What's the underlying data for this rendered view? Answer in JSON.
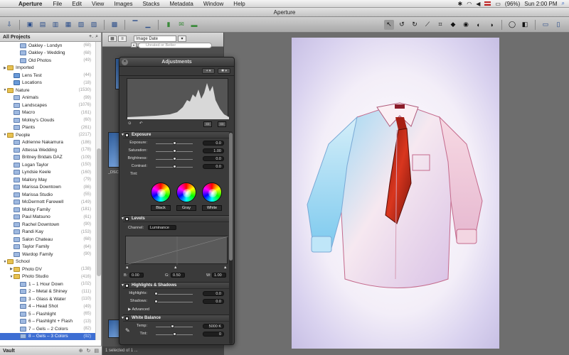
{
  "menubar": {
    "app": "Aperture",
    "items": [
      "File",
      "Edit",
      "View",
      "Images",
      "Stacks",
      "Metadata",
      "Window",
      "Help"
    ],
    "battery": "(96%)",
    "clock": "Sun 2:00 PM"
  },
  "window": {
    "title": "Aperture"
  },
  "sidebar": {
    "header": "All Projects",
    "footer": "Vault",
    "rows": [
      {
        "label": "Oakley - Londyn",
        "count": "(68)",
        "indent": 2,
        "icon": "album"
      },
      {
        "label": "Oakley - Wedding",
        "count": "(68)",
        "indent": 2,
        "icon": "album"
      },
      {
        "label": "Old Photos",
        "count": "(49)",
        "indent": 2,
        "icon": "album"
      },
      {
        "label": "Imported",
        "count": "",
        "indent": 0,
        "icon": "folder",
        "tri": "▶"
      },
      {
        "label": "Lens Test",
        "count": "(44)",
        "indent": 1,
        "icon": "proj"
      },
      {
        "label": "Locations",
        "count": "(18)",
        "indent": 1,
        "icon": "proj"
      },
      {
        "label": "Nature",
        "count": "(1530)",
        "indent": 0,
        "icon": "folder",
        "tri": "▼"
      },
      {
        "label": "Animals",
        "count": "(99)",
        "indent": 1,
        "icon": "album"
      },
      {
        "label": "Landscapes",
        "count": "(1076)",
        "indent": 1,
        "icon": "album"
      },
      {
        "label": "Macro",
        "count": "(161)",
        "indent": 1,
        "icon": "album"
      },
      {
        "label": "Molloy's Clouds",
        "count": "(60)",
        "indent": 1,
        "icon": "album"
      },
      {
        "label": "Plants",
        "count": "(261)",
        "indent": 1,
        "icon": "album"
      },
      {
        "label": "People",
        "count": "(2217)",
        "indent": 0,
        "icon": "folder",
        "tri": "▼"
      },
      {
        "label": "Adrienne Nakamura",
        "count": "(186)",
        "indent": 1,
        "icon": "album"
      },
      {
        "label": "Attessa Wedding",
        "count": "(178)",
        "indent": 1,
        "icon": "album"
      },
      {
        "label": "Britney Bridals DAZ",
        "count": "(109)",
        "indent": 1,
        "icon": "album"
      },
      {
        "label": "Logan Taylor",
        "count": "(150)",
        "indent": 1,
        "icon": "album"
      },
      {
        "label": "Lyndsie Keele",
        "count": "(160)",
        "indent": 1,
        "icon": "album"
      },
      {
        "label": "Mallory May",
        "count": "(79)",
        "indent": 1,
        "icon": "album"
      },
      {
        "label": "Marissa Downtown",
        "count": "(86)",
        "indent": 1,
        "icon": "album"
      },
      {
        "label": "Marissa Studio",
        "count": "(55)",
        "indent": 1,
        "icon": "album"
      },
      {
        "label": "McDermott Farewell",
        "count": "(149)",
        "indent": 1,
        "icon": "album"
      },
      {
        "label": "Molloy Family",
        "count": "(181)",
        "indent": 1,
        "icon": "album"
      },
      {
        "label": "Paul Matsuno",
        "count": "(61)",
        "indent": 1,
        "icon": "album"
      },
      {
        "label": "Rachel Downtown",
        "count": "(90)",
        "indent": 1,
        "icon": "album"
      },
      {
        "label": "Randi Kay",
        "count": "(153)",
        "indent": 1,
        "icon": "album"
      },
      {
        "label": "Salon Chateau",
        "count": "(68)",
        "indent": 1,
        "icon": "album"
      },
      {
        "label": "Taylor Family",
        "count": "(64)",
        "indent": 1,
        "icon": "album"
      },
      {
        "label": "Wardop Family",
        "count": "(90)",
        "indent": 1,
        "icon": "album"
      },
      {
        "label": "School",
        "count": "",
        "indent": 0,
        "icon": "folder",
        "tri": "▼"
      },
      {
        "label": "Photo DV",
        "count": "(138)",
        "indent": 1,
        "icon": "folder",
        "tri": "▶"
      },
      {
        "label": "Photo Studio",
        "count": "(416)",
        "indent": 1,
        "icon": "folder",
        "tri": "▼"
      },
      {
        "label": "1 – 1 Hour Down",
        "count": "(102)",
        "indent": 2,
        "icon": "album"
      },
      {
        "label": "2 – Metal & Shiney",
        "count": "(111)",
        "indent": 2,
        "icon": "album"
      },
      {
        "label": "3 – Glass & Water",
        "count": "(110)",
        "indent": 2,
        "icon": "album"
      },
      {
        "label": "4 – Head Shot",
        "count": "(49)",
        "indent": 2,
        "icon": "album"
      },
      {
        "label": "5 – Flashlight",
        "count": "(65)",
        "indent": 2,
        "icon": "album"
      },
      {
        "label": "6 – Flashlight + Flash",
        "count": "(13)",
        "indent": 2,
        "icon": "album"
      },
      {
        "label": "7 – Gels – 2 Colors",
        "count": "(82)",
        "indent": 2,
        "icon": "album"
      },
      {
        "label": "8 – Gels – 3 Colors",
        "count": "(92)",
        "indent": 2,
        "icon": "album",
        "selected": true
      }
    ]
  },
  "browser": {
    "sort": "Image Date",
    "filter_placeholder": "Unrated or Better",
    "status": "1 selected of 1 ...",
    "thumb_label": "_DSC"
  },
  "adjustments": {
    "title": "Adjustments",
    "exposure": {
      "header": "Exposure",
      "rows": [
        {
          "label": "Exposure:",
          "value": "0.0",
          "knob": 0.5
        },
        {
          "label": "Saturation:",
          "value": "1.00",
          "knob": 0.5
        },
        {
          "label": "Brightness:",
          "value": "0.0",
          "knob": 0.5
        },
        {
          "label": "Contrast:",
          "value": "0.0",
          "knob": 0.5
        }
      ],
      "tint_label": "Tint:",
      "wheels": [
        "Black",
        "Gray",
        "White"
      ]
    },
    "levels": {
      "header": "Levels",
      "channel_label": "Channel:",
      "channel_value": "Luminance",
      "b_label": "B:",
      "b_value": "0.00",
      "g_label": "G:",
      "g_value": "0.50",
      "w_label": "W:",
      "w_value": "1.00"
    },
    "highlights": {
      "header": "Highlights & Shadows",
      "rows": [
        {
          "label": "Highlights:",
          "value": "0.0",
          "knob": 0
        },
        {
          "label": "Shadows:",
          "value": "0.0",
          "knob": 0
        }
      ],
      "advanced": "Advanced"
    },
    "white_balance": {
      "header": "White Balance",
      "rows": [
        {
          "label": "Temp:",
          "value": "5000 K",
          "knob": 0.45
        },
        {
          "label": "Tint:",
          "value": "0",
          "knob": 0.5
        }
      ]
    }
  },
  "colors": {
    "selection": "#3d6ed3",
    "tie": "#c62a16",
    "shirt": "#f7e6f0"
  }
}
